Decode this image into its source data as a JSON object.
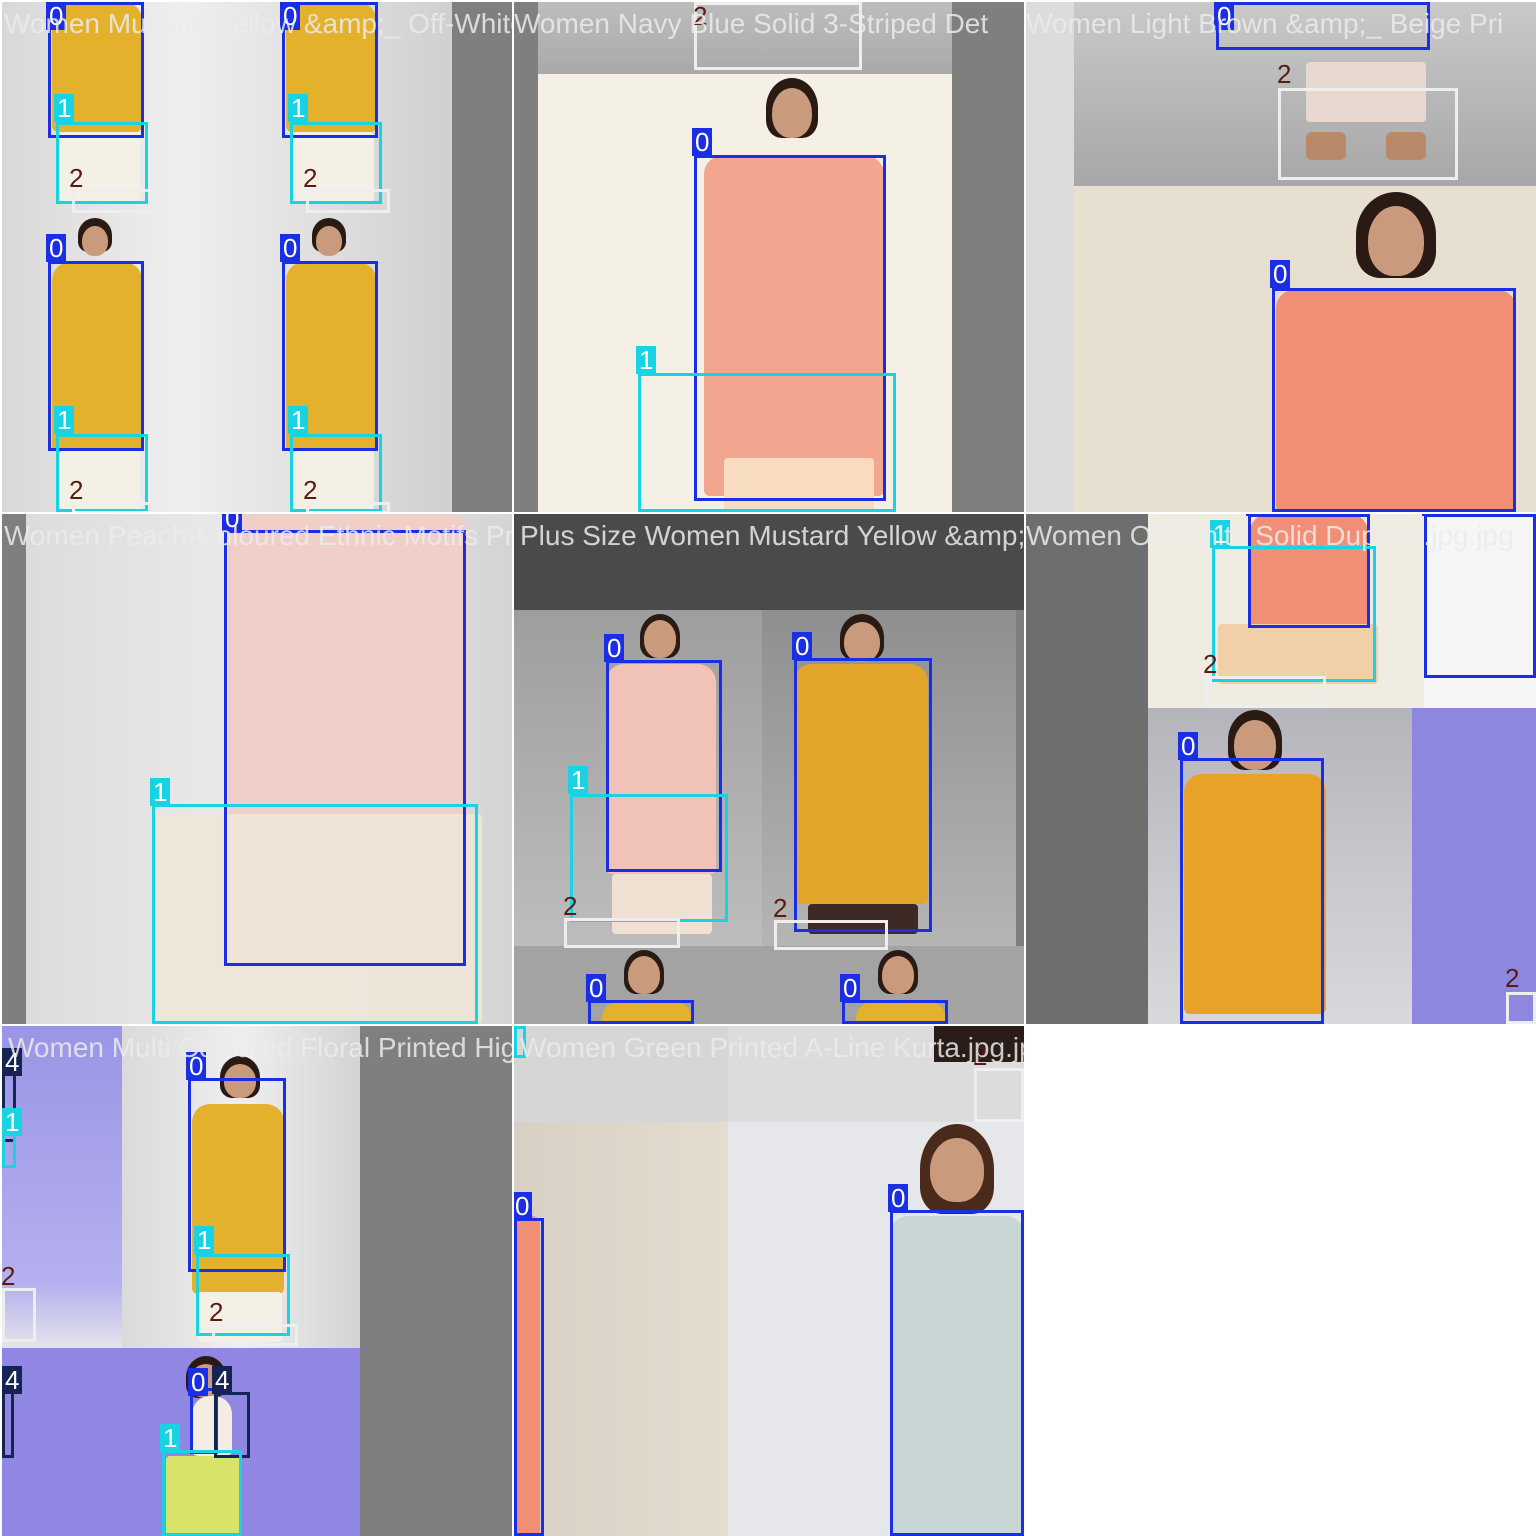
{
  "tiles": [
    {
      "title": "Women Mustard Yellow &amp;_ Off-White Eth"
    },
    {
      "title": "Women Navy Blue Solid 3-Striped Det"
    },
    {
      "title": "Women Light Brown &amp;_ Beige Pri"
    },
    {
      "title": "Women Peach-Coloured Ethnic Motifs Print"
    },
    {
      "title": "Plus Size Women Mustard Yellow &amp;_ White"
    },
    {
      "title": "Women Off-White Solid Dupatta.jpg.jpg"
    },
    {
      "title": "Women Multi Coloured Floral Printed High"
    },
    {
      "title": "Women Green Printed A-Line Kurta.jpg.jpg"
    }
  ],
  "labels": {
    "c0": "0",
    "c1": "1",
    "c2": "2",
    "c4": "4"
  },
  "colors": {
    "class0": "#1a2ee6",
    "class1": "#18d3e3",
    "class2": "#eeeeee",
    "class4": "#162455",
    "mustard": "#e3b12c",
    "peach": "#f2a690",
    "floral": "#c9d6d8"
  }
}
